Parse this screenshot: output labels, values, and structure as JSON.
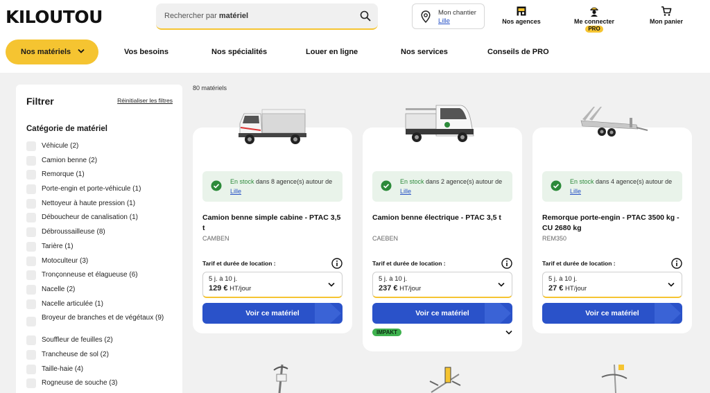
{
  "header": {
    "logo": "KILOUTOU",
    "search": {
      "prefix": "Rechercher par ",
      "bold": "matériel"
    },
    "chantier": {
      "label": "Mon chantier",
      "city": "Lille"
    },
    "agences": "Nos agences",
    "connect": "Me connecter",
    "pro": "PRO",
    "panier": "Mon panier"
  },
  "nav": {
    "main": "Nos matériels",
    "links": [
      "Vos besoins",
      "Nos spécialités",
      "Louer en ligne",
      "Nos services",
      "Conseils de PRO"
    ]
  },
  "sidebar": {
    "title": "Filtrer",
    "reset": "Réinitialiser les filtres",
    "category_title": "Catégorie de matériel",
    "items": [
      "Véhicule (2)",
      "Camion benne (2)",
      "Remorque (1)",
      "Porte-engin et porte-véhicule (1)",
      "Nettoyeur à haute pression (1)",
      "Déboucheur de canalisation (1)",
      "Débroussailleuse (8)",
      "Tarière (1)",
      "Motoculteur (3)",
      "Tronçonneuse et élagueuse (6)",
      "Nacelle (2)",
      "Nacelle articulée (1)",
      "Broyeur de branches et de végétaux (9)",
      "Souffleur de feuilles (2)",
      "Trancheuse de sol (2)",
      "Taille-haie (4)",
      "Rogneuse de souche (3)"
    ]
  },
  "results": {
    "count": "80 matériels"
  },
  "cards": [
    {
      "in_stock": "En stock",
      "availability": " dans 8 agence(s) autour de ",
      "city": "Lille",
      "name": "Camion benne simple cabine - PTAC 3,5 t",
      "code": "CAMBEN",
      "tarif_label": "Tarif et durée de location :",
      "duration": "5 j. à 10 j.",
      "price": "129 €",
      "unit": " HT/jour",
      "cta": "Voir ce matériel"
    },
    {
      "in_stock": "En stock",
      "availability": " dans 2 agence(s) autour de ",
      "city": "Lille",
      "name": "Camion benne électrique - PTAC 3,5 t",
      "code": "CAEBEN",
      "tarif_label": "Tarif et durée de location :",
      "duration": "5 j. à 10 j.",
      "price": "237 €",
      "unit": " HT/jour",
      "cta": "Voir ce matériel",
      "badge": "IMPAKT"
    },
    {
      "in_stock": "En stock",
      "availability": " dans 4 agence(s) autour de ",
      "city": "Lille",
      "name": "Remorque porte-engin - PTAC 3500 kg - CU 2680 kg",
      "code": "REM350",
      "tarif_label": "Tarif et durée de location :",
      "duration": "5 j. à 10 j.",
      "price": "27 €",
      "unit": " HT/jour",
      "cta": "Voir ce matériel"
    }
  ],
  "colors": {
    "brand_yellow": "#f5c431",
    "cta_blue": "#2a52c9",
    "stock_green": "#2c8a3a",
    "stock_bg": "#e9f3ea"
  }
}
